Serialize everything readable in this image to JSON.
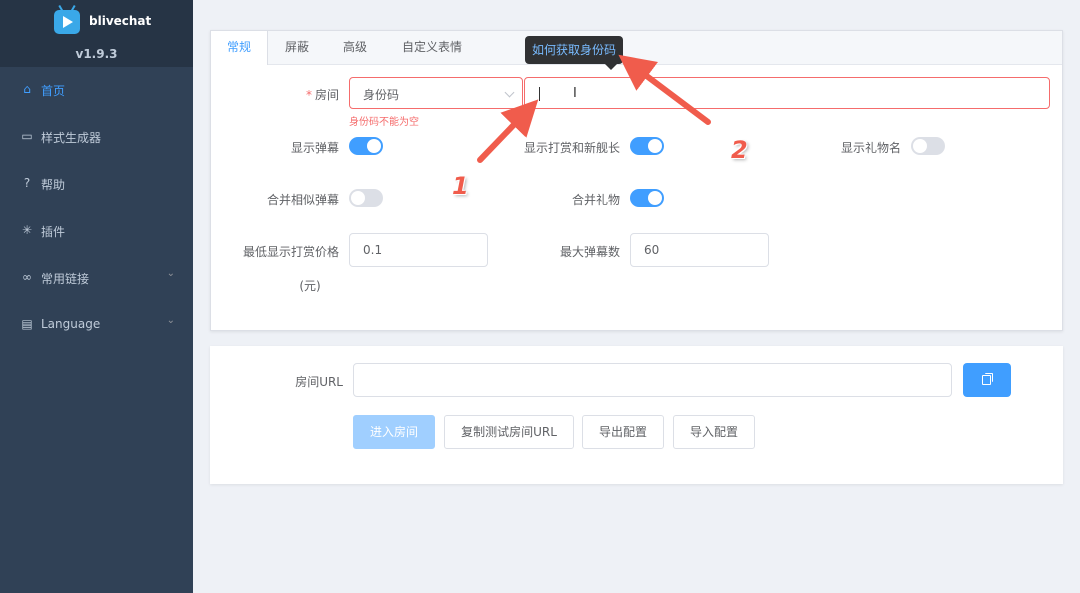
{
  "sidebar": {
    "app_name": "blivechat",
    "version": "v1.9.3",
    "items": [
      {
        "label": "首页",
        "icon": "home-icon",
        "active": true
      },
      {
        "label": "样式生成器",
        "icon": "brush-icon"
      },
      {
        "label": "帮助",
        "icon": "help-icon"
      },
      {
        "label": "插件",
        "icon": "plugin-icon"
      },
      {
        "label": "常用链接",
        "icon": "link-icon",
        "has_submenu": true
      },
      {
        "label": "Language",
        "icon": "chat-icon",
        "has_submenu": true
      }
    ]
  },
  "tabs": [
    {
      "label": "常规",
      "active": true
    },
    {
      "label": "屏蔽"
    },
    {
      "label": "高级"
    },
    {
      "label": "自定义表情"
    }
  ],
  "form": {
    "room_label": "房间",
    "room_type_value": "身份码",
    "room_code_value": "",
    "room_error": "身份码不能为空",
    "tooltip": "如何获取身份码",
    "show_danmaku_label": "显示弹幕",
    "show_danmaku": true,
    "show_gift_label": "显示打赏和新舰长",
    "show_gift": true,
    "show_gift_name_label": "显示礼物名",
    "show_gift_name": false,
    "merge_similar_label": "合并相似弹幕",
    "merge_similar": false,
    "merge_gift_label": "合并礼物",
    "merge_gift": true,
    "min_price_label_line1": "最低显示打赏价格",
    "min_price_label_line2": "(元)",
    "min_price_value": "0.1",
    "max_danmaku_label": "最大弹幕数",
    "max_danmaku_value": "60"
  },
  "url_section": {
    "label": "房间URL",
    "value": "",
    "buttons": {
      "enter_room": "进入房间",
      "copy_test_url": "复制测试房间URL",
      "export_config": "导出配置",
      "import_config": "导入配置"
    }
  },
  "annotations": {
    "one": "1",
    "two": "2"
  },
  "colors": {
    "accent": "#409eff",
    "error": "#f56c6c",
    "sidebar": "#304156",
    "annotation": "#f05c4c"
  }
}
